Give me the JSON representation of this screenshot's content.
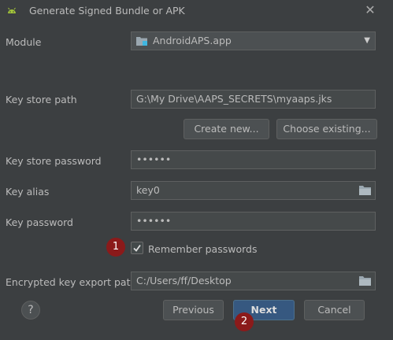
{
  "window": {
    "title": "Generate Signed Bundle or APK",
    "close_glyph": "✕",
    "icon": "android-icon"
  },
  "module": {
    "label": "Module",
    "value": "AndroidAPS.app",
    "icon": "module-folder-icon",
    "arrow": "▼"
  },
  "key_store_path": {
    "label": "Key store path",
    "value": "G:\\My Drive\\AAPS_SECRETS\\myaaps.jks"
  },
  "buttons": {
    "create_new": "Create new...",
    "choose_existing": "Choose existing...",
    "previous": "Previous",
    "next": "Next",
    "cancel": "Cancel",
    "help": "?"
  },
  "key_store_password": {
    "label": "Key store password",
    "value": "••••••"
  },
  "key_alias": {
    "label": "Key alias",
    "value": "key0"
  },
  "key_password": {
    "label": "Key password",
    "value": "••••••"
  },
  "remember_passwords": {
    "label": "Remember passwords",
    "checked": true,
    "check_glyph": "✓"
  },
  "export_path": {
    "label": "Encrypted key export path",
    "value": "C:/Users/ff/Desktop"
  },
  "annotations": {
    "badge1": "1",
    "badge2": "2"
  },
  "colors": {
    "background": "#3c3f41",
    "field": "#45494a",
    "primary_button": "#365880",
    "badge": "#8b1a1a",
    "android_green": "#a4c639"
  }
}
